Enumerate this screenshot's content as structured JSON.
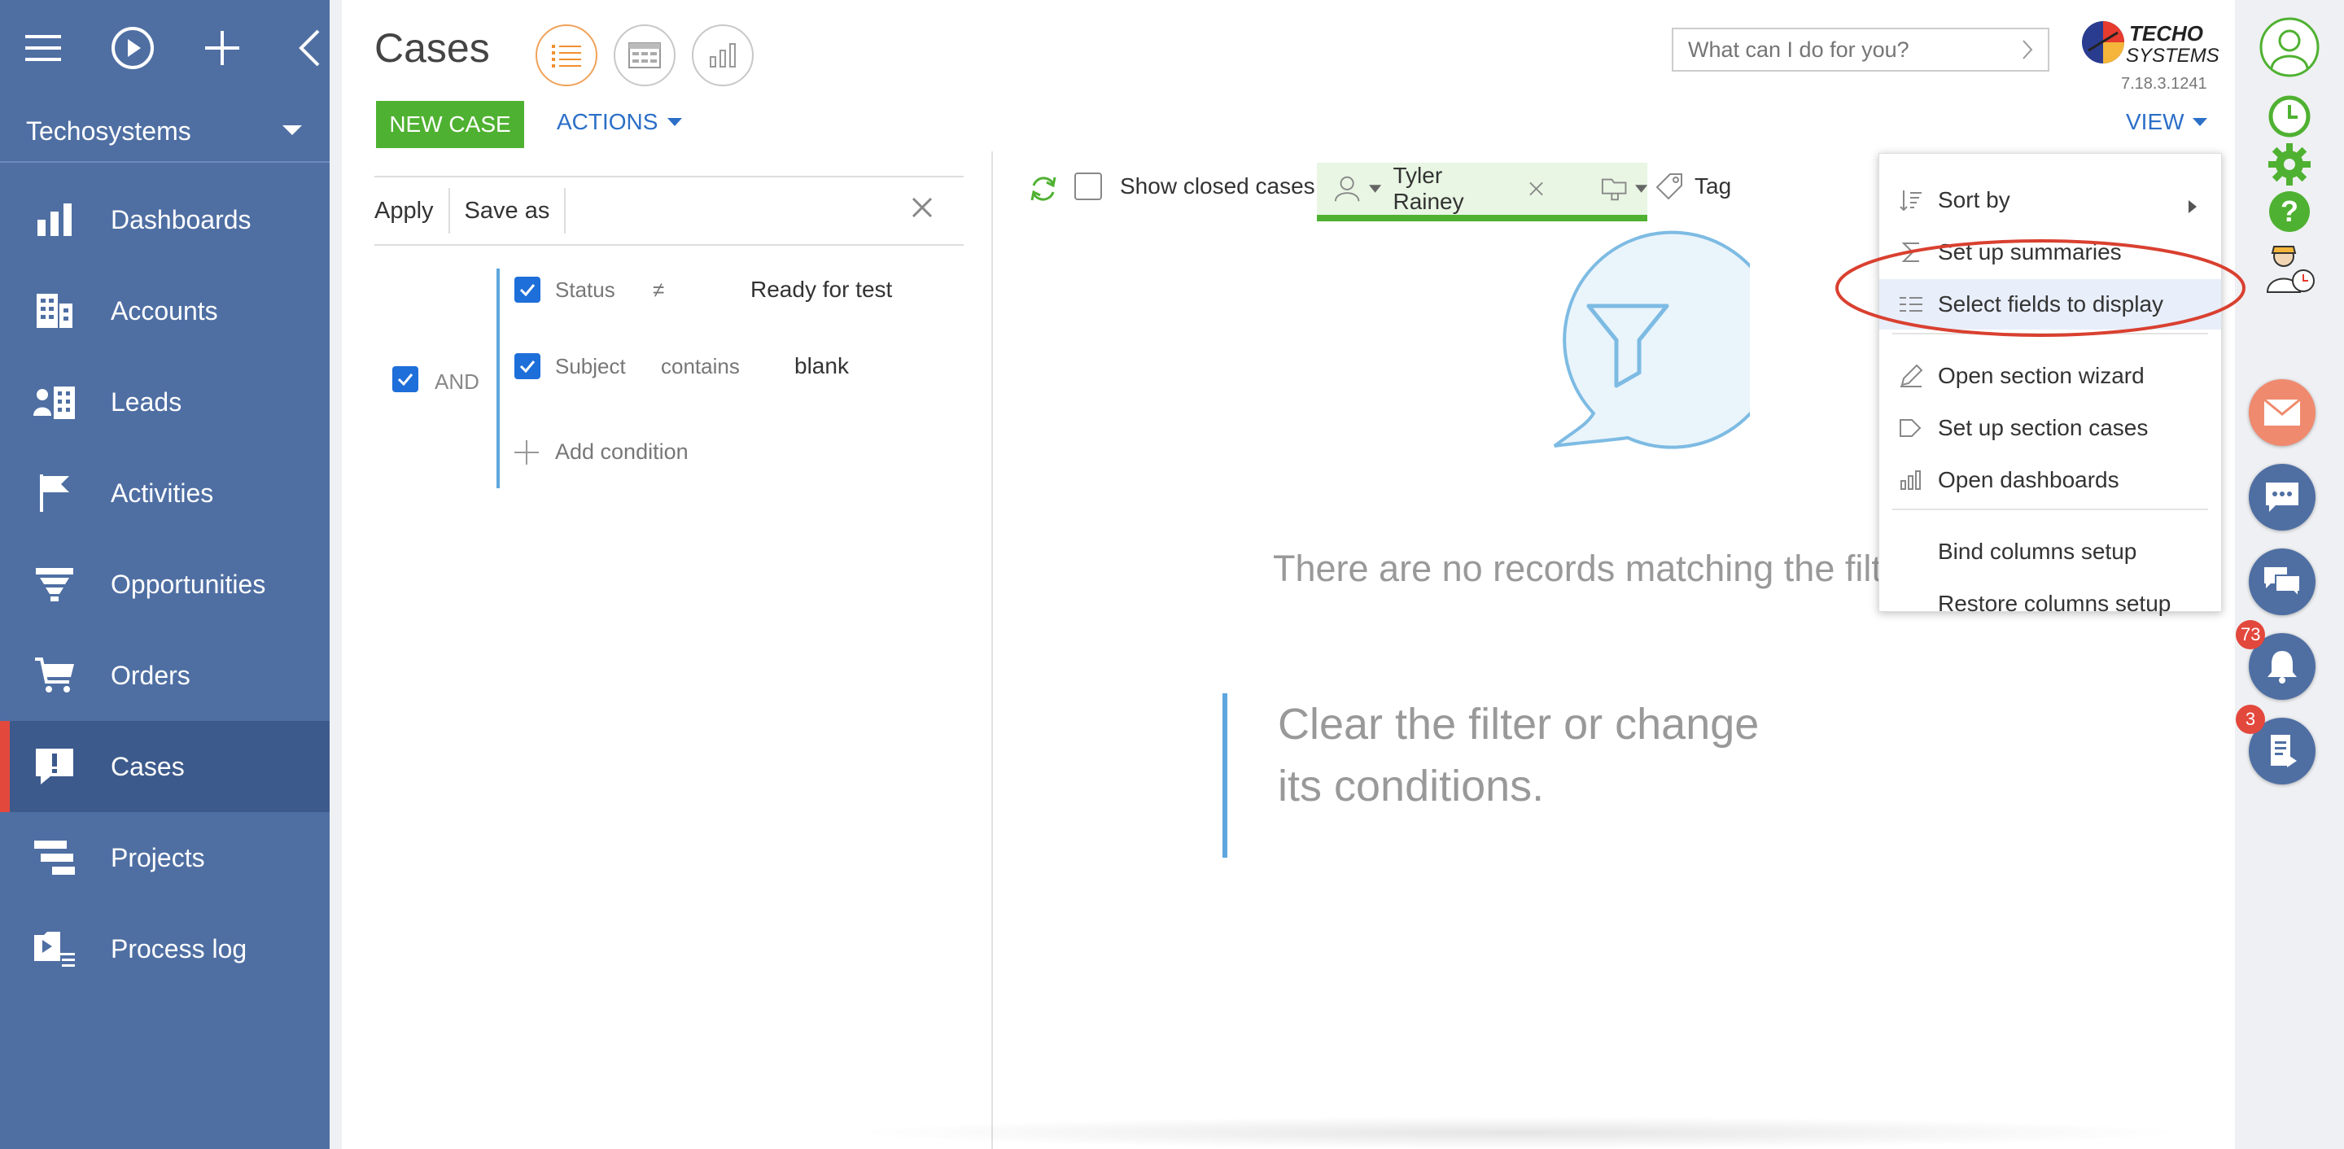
{
  "sidebar": {
    "top_icons": [
      "hamburger-icon",
      "play-icon",
      "plus-icon",
      "collapse-left-icon"
    ],
    "workspace": "Techosystems",
    "items": [
      {
        "label": "Dashboards",
        "icon": "bar-chart-icon"
      },
      {
        "label": "Accounts",
        "icon": "building-icon"
      },
      {
        "label": "Leads",
        "icon": "leads-icon"
      },
      {
        "label": "Activities",
        "icon": "flag-icon"
      },
      {
        "label": "Opportunities",
        "icon": "funnel-icon"
      },
      {
        "label": "Orders",
        "icon": "cart-icon"
      },
      {
        "label": "Cases",
        "icon": "case-alert-icon",
        "active": true
      },
      {
        "label": "Projects",
        "icon": "projects-icon"
      },
      {
        "label": "Process log",
        "icon": "process-log-icon"
      }
    ]
  },
  "header": {
    "title": "Cases",
    "new_case": "NEW CASE",
    "actions": "ACTIONS",
    "view": "VIEW",
    "search_placeholder": "What can I do for you?",
    "logo_text_1": "TECHO",
    "logo_text_2": "SYSTEMS",
    "version": "7.18.3.1241"
  },
  "filter": {
    "apply": "Apply",
    "save_as": "Save as",
    "group_operator": "AND",
    "conditions": [
      {
        "field": "Status",
        "operator": "≠",
        "value": "Ready for test"
      },
      {
        "field": "Subject",
        "operator": "contains",
        "value": "blank"
      }
    ],
    "add_condition": "Add condition"
  },
  "toolbar": {
    "show_closed": "Show closed cases",
    "owner": "Tyler Rainey",
    "tag": "Tag"
  },
  "empty_state": {
    "message": "There are no records matching the filter criteria.",
    "hint": "Clear the filter or change its conditions."
  },
  "view_menu": {
    "items": [
      {
        "label": "Sort by",
        "icon": "sort-icon",
        "submenu": true
      },
      {
        "label": "Set up summaries",
        "icon": "sigma-icon"
      },
      {
        "label": "Select fields to display",
        "icon": "columns-icon",
        "highlighted": true
      },
      {
        "label": "Open section wizard",
        "icon": "pencil-icon"
      },
      {
        "label": "Set up section cases",
        "icon": "process-arrow-icon"
      },
      {
        "label": "Open dashboards",
        "icon": "bar-chart-icon"
      },
      {
        "label": "Bind columns setup",
        "icon": ""
      },
      {
        "label": "Restore columns setup",
        "icon": ""
      }
    ]
  },
  "right_rail": {
    "notifications_count": "73",
    "feed_count": "3"
  },
  "colors": {
    "sidebar": "#4f6fa3",
    "sidebar_active": "#3d5a8c",
    "accent_red": "#e3483d",
    "green": "#4fb131",
    "link_blue": "#2b6fc7",
    "highlight_circle": "#d94030"
  }
}
